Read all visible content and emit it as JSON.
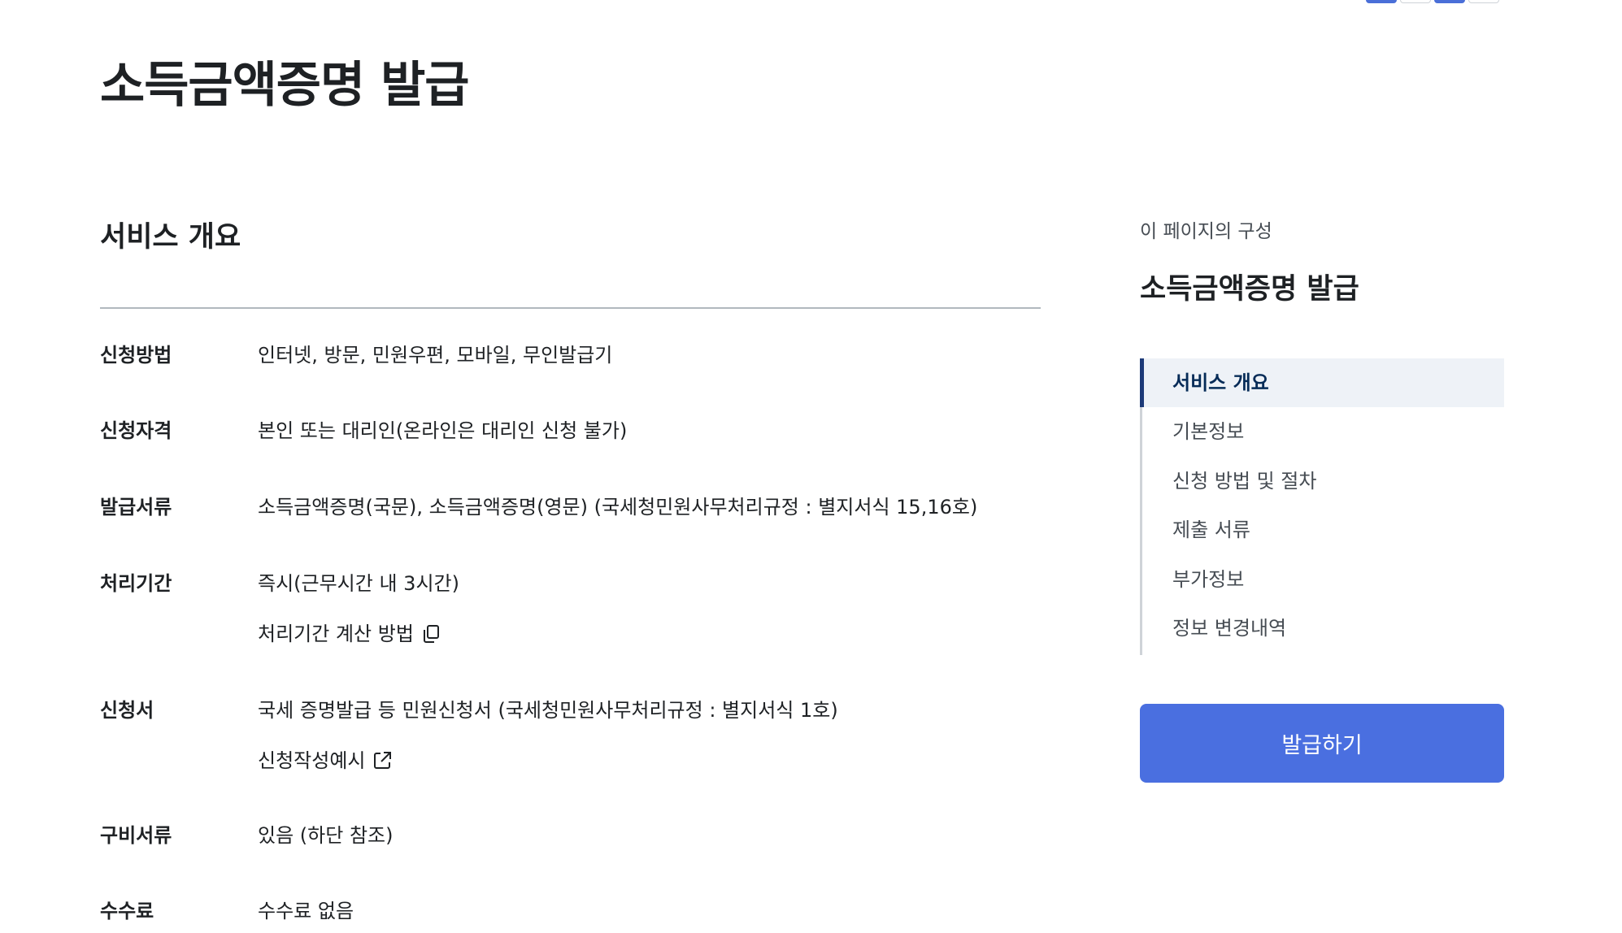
{
  "header": {
    "title": "소득금액증명 발급"
  },
  "overview": {
    "section_title": "서비스 개요",
    "rows": [
      {
        "label": "신청방법",
        "value": "인터넷, 방문, 민원우편, 모바일, 무인발급기"
      },
      {
        "label": "신청자격",
        "value": "본인 또는 대리인(온라인은 대리인 신청 불가)"
      },
      {
        "label": "발급서류",
        "value": "소득금액증명(국문), 소득금액증명(영문) (국세청민원사무처리규정 : 별지서식 15,16호)"
      },
      {
        "label": "처리기간",
        "value": "즉시(근무시간 내 3시간)",
        "link": "처리기간 계산 방법",
        "link_icon": "copy-icon"
      },
      {
        "label": "신청서",
        "value": "국세 증명발급 등 민원신청서 (국세청민원사무처리규정 : 별지서식 1호)",
        "link": "신청작성예시",
        "link_icon": "external-link-icon"
      },
      {
        "label": "구비서류",
        "value": "있음 (하단 참조)"
      },
      {
        "label": "수수료",
        "value": "수수료 없음"
      }
    ]
  },
  "toc": {
    "caption": "이 페이지의 구성",
    "title": "소득금액증명 발급",
    "items": [
      {
        "label": "서비스 개요",
        "active": true
      },
      {
        "label": "기본정보"
      },
      {
        "label": "신청 방법 및 절차"
      },
      {
        "label": "제출 서류"
      },
      {
        "label": "부가정보"
      },
      {
        "label": "정보 변경내역"
      }
    ]
  },
  "actions": {
    "issue_label": "발급하기"
  },
  "colors": {
    "accent": "#4a6fe0",
    "active_bar": "#1d3a78",
    "active_bg": "#eef2f7",
    "divider": "#b1b8be"
  }
}
